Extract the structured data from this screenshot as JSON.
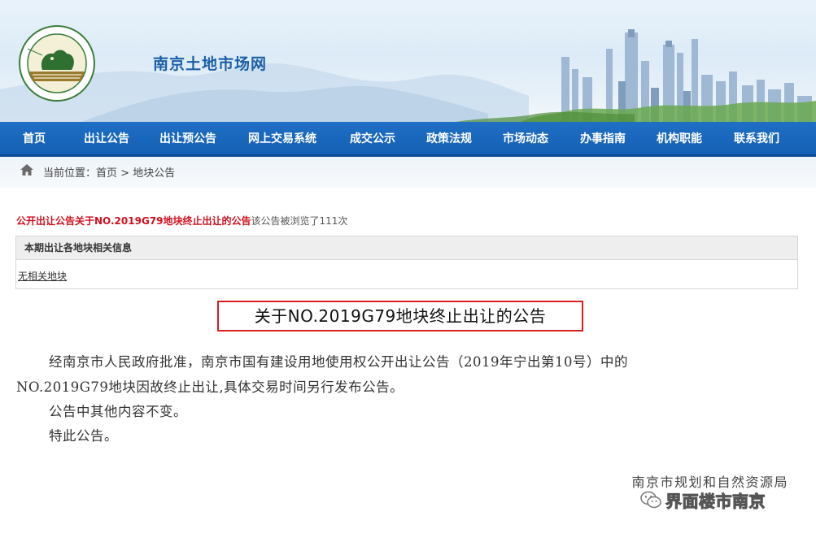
{
  "header": {
    "site_title": "南京土地市场网"
  },
  "nav": {
    "items": [
      {
        "label": "首页"
      },
      {
        "label": "出让公告"
      },
      {
        "label": "出让预公告"
      },
      {
        "label": "网上交易系统"
      },
      {
        "label": "成交公示"
      },
      {
        "label": "政策法规"
      },
      {
        "label": "市场动态"
      },
      {
        "label": "办事指南"
      },
      {
        "label": "机构职能"
      },
      {
        "label": "联系我们"
      }
    ]
  },
  "breadcrumb": {
    "prefix": "当前位置：",
    "home": "首页",
    "sep": " > ",
    "current": "地块公告"
  },
  "notice": {
    "title_link": "公开出让公告关于NO.2019G79地块终止出让的公告",
    "view_prefix": "该公告被浏览了",
    "view_count": "111",
    "view_suffix": "次"
  },
  "info_box": {
    "header": "本期出让各地块相关信息",
    "link": "无相关地块"
  },
  "document": {
    "title": "关于NO.2019G79地块终止出让的公告",
    "para1_line1": "经南京市人民政府批准，南京市国有建设用地使用权公开出让公告（2019年宁出第10号）中的",
    "para1_line2": "NO.2019G79地块因故终止出让,具体交易时间另行发布公告。",
    "para2": "公告中其他内容不变。",
    "para3": "特此公告。",
    "signature": "南京市规划和自然资源局"
  },
  "watermark": {
    "text": "界面楼市南京",
    "icon": "wechat-icon"
  },
  "colors": {
    "nav_bg": "#1a68bd",
    "title_link_red": "#d0101e",
    "frame_red": "#d81e1e",
    "site_title_blue": "#1d5fa8"
  }
}
